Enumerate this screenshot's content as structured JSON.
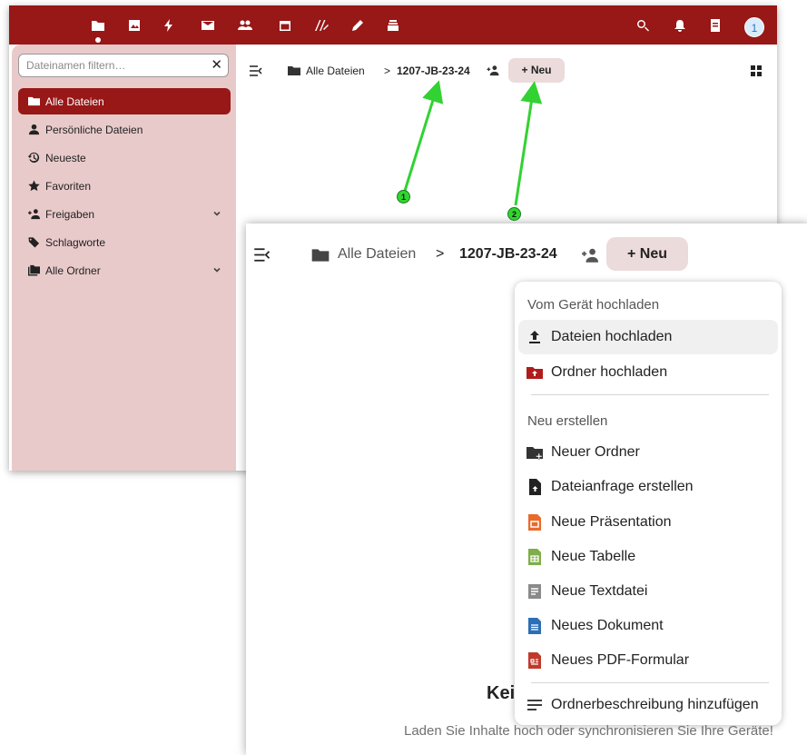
{
  "topbar": {
    "apps": [
      {
        "icon": "folder-icon"
      },
      {
        "icon": "image-icon"
      },
      {
        "icon": "lightning-icon"
      },
      {
        "icon": "mail-icon"
      },
      {
        "icon": "contacts-icon"
      },
      {
        "icon": "calendar-icon"
      },
      {
        "icon": "signature-icon"
      },
      {
        "icon": "pencil-icon"
      },
      {
        "icon": "deck-icon"
      }
    ],
    "right_icons": [
      "search-icon",
      "notifications-icon",
      "contacts-book-icon"
    ],
    "avatar_label": "1",
    "accent": "#981717"
  },
  "sidebar": {
    "filter_placeholder": "Dateinamen filtern…",
    "items": [
      {
        "label": "Alle Dateien",
        "icon": "folder-icon",
        "active": true
      },
      {
        "label": "Persönliche Dateien",
        "icon": "person-icon"
      },
      {
        "label": "Neueste",
        "icon": "history-icon"
      },
      {
        "label": "Favoriten",
        "icon": "star-icon"
      },
      {
        "label": "Freigaben",
        "icon": "share-icon",
        "expandable": true
      },
      {
        "label": "Schlagworte",
        "icon": "tag-icon"
      },
      {
        "label": "Alle Ordner",
        "icon": "folders-icon",
        "expandable": true
      }
    ],
    "background": "#e9caca"
  },
  "breadcrumb": {
    "root": "Alle Dateien",
    "separator": ">",
    "current": "1207-JB-23-24",
    "new_button": "+ Neu"
  },
  "menu": {
    "upload_caption": "Vom Gerät hochladen",
    "upload_items": [
      {
        "label": "Dateien hochladen",
        "icon": "upload-icon"
      },
      {
        "label": "Ordner hochladen",
        "icon": "folder-upload-icon"
      }
    ],
    "create_caption": "Neu erstellen",
    "create_items": [
      {
        "label": "Neuer Ordner",
        "icon": "folder-plus-icon"
      },
      {
        "label": "Dateianfrage erstellen",
        "icon": "file-request-icon"
      },
      {
        "label": "Neue Präsentation",
        "icon": "presentation-icon"
      },
      {
        "label": "Neue Tabelle",
        "icon": "spreadsheet-icon"
      },
      {
        "label": "Neue Textdatei",
        "icon": "text-file-icon"
      },
      {
        "label": "Neues Dokument",
        "icon": "document-icon"
      },
      {
        "label": "Neues PDF-Formular",
        "icon": "pdf-form-icon"
      }
    ],
    "description_item": {
      "label": "Ordnerbeschreibung hinzufügen",
      "icon": "lines-icon"
    }
  },
  "empty": {
    "title": "Kei",
    "subtitle": "Laden Sie Inhalte hoch oder synchronisieren Sie Ihre Geräte!"
  },
  "annotations": {
    "badge1": "1",
    "badge2": "2",
    "color": "#2fd62f"
  }
}
